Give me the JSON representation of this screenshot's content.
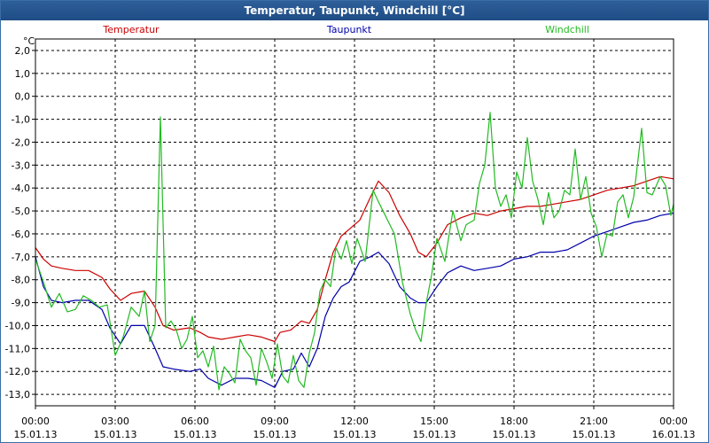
{
  "window": {
    "title": "Temperatur, Taupunkt, Windchill [°C]"
  },
  "chart_data": {
    "type": "line",
    "unit": "°C",
    "ylim": [
      -13.5,
      2.5
    ],
    "xlim": [
      0,
      24
    ],
    "grid": true,
    "y_ticks": [
      2.0,
      1.0,
      0.0,
      -1.0,
      -2.0,
      -3.0,
      -4.0,
      -5.0,
      -6.0,
      -7.0,
      -8.0,
      -9.0,
      -10.0,
      -11.0,
      -12.0,
      -13.0
    ],
    "y_tick_labels": [
      "2,0",
      "1,0",
      "0,0",
      "-1,0",
      "-2,0",
      "-3,0",
      "-4,0",
      "-5,0",
      "-6,0",
      "-7,0",
      "-8,0",
      "-9,0",
      "-10,0",
      "-11,0",
      "-12,0",
      "-13,0"
    ],
    "x_ticks": [
      {
        "hours": 0,
        "time": "00:00",
        "date": "15.01.13"
      },
      {
        "hours": 3,
        "time": "03:00",
        "date": "15.01.13"
      },
      {
        "hours": 6,
        "time": "06:00",
        "date": "15.01.13"
      },
      {
        "hours": 9,
        "time": "09:00",
        "date": "15.01.13"
      },
      {
        "hours": 12,
        "time": "12:00",
        "date": "15.01.13"
      },
      {
        "hours": 15,
        "time": "15:00",
        "date": "15.01.13"
      },
      {
        "hours": 18,
        "time": "18:00",
        "date": "15.01.13"
      },
      {
        "hours": 21,
        "time": "21:00",
        "date": "15.01.13"
      },
      {
        "hours": 24,
        "time": "00:00",
        "date": "16.01.13"
      }
    ],
    "series": [
      {
        "name": "Temperatur",
        "color": "#cc0000",
        "points": [
          [
            0,
            -6.6
          ],
          [
            0.3,
            -7.1
          ],
          [
            0.6,
            -7.4
          ],
          [
            1,
            -7.5
          ],
          [
            1.5,
            -7.6
          ],
          [
            2,
            -7.6
          ],
          [
            2.5,
            -7.9
          ],
          [
            2.8,
            -8.4
          ],
          [
            3.2,
            -8.9
          ],
          [
            3.6,
            -8.6
          ],
          [
            4.1,
            -8.5
          ],
          [
            4.5,
            -9.2
          ],
          [
            4.8,
            -10.0
          ],
          [
            5.2,
            -10.2
          ],
          [
            5.8,
            -10.1
          ],
          [
            6.2,
            -10.3
          ],
          [
            6.5,
            -10.5
          ],
          [
            7,
            -10.6
          ],
          [
            7.5,
            -10.5
          ],
          [
            8,
            -10.4
          ],
          [
            8.5,
            -10.5
          ],
          [
            9,
            -10.7
          ],
          [
            9.2,
            -10.3
          ],
          [
            9.6,
            -10.2
          ],
          [
            10,
            -9.8
          ],
          [
            10.3,
            -9.9
          ],
          [
            10.6,
            -9.3
          ],
          [
            10.9,
            -8.0
          ],
          [
            11.2,
            -6.8
          ],
          [
            11.5,
            -6.1
          ],
          [
            11.8,
            -5.8
          ],
          [
            12.2,
            -5.4
          ],
          [
            12.6,
            -4.4
          ],
          [
            12.9,
            -3.7
          ],
          [
            13.3,
            -4.2
          ],
          [
            13.7,
            -5.2
          ],
          [
            14.1,
            -6.0
          ],
          [
            14.4,
            -6.8
          ],
          [
            14.7,
            -7.0
          ],
          [
            15.1,
            -6.4
          ],
          [
            15.5,
            -5.6
          ],
          [
            16,
            -5.3
          ],
          [
            16.5,
            -5.1
          ],
          [
            17,
            -5.2
          ],
          [
            17.5,
            -5.0
          ],
          [
            18,
            -4.9
          ],
          [
            18.5,
            -4.8
          ],
          [
            19,
            -4.8
          ],
          [
            19.5,
            -4.7
          ],
          [
            20,
            -4.6
          ],
          [
            20.5,
            -4.5
          ],
          [
            21,
            -4.3
          ],
          [
            21.5,
            -4.1
          ],
          [
            22,
            -4.0
          ],
          [
            22.5,
            -3.9
          ],
          [
            23,
            -3.7
          ],
          [
            23.5,
            -3.5
          ],
          [
            24,
            -3.6
          ]
        ]
      },
      {
        "name": "Taupunkt",
        "color": "#0000aa",
        "points": [
          [
            0,
            -7.0
          ],
          [
            0.3,
            -8.3
          ],
          [
            0.6,
            -8.9
          ],
          [
            1,
            -9.0
          ],
          [
            1.5,
            -8.9
          ],
          [
            2,
            -8.9
          ],
          [
            2.5,
            -9.3
          ],
          [
            2.8,
            -10.1
          ],
          [
            3.2,
            -10.8
          ],
          [
            3.6,
            -10.0
          ],
          [
            4.1,
            -10.0
          ],
          [
            4.5,
            -11.0
          ],
          [
            4.8,
            -11.8
          ],
          [
            5.2,
            -11.9
          ],
          [
            5.8,
            -12.0
          ],
          [
            6.2,
            -11.9
          ],
          [
            6.5,
            -12.3
          ],
          [
            7,
            -12.6
          ],
          [
            7.5,
            -12.3
          ],
          [
            8,
            -12.3
          ],
          [
            8.5,
            -12.4
          ],
          [
            9,
            -12.7
          ],
          [
            9.3,
            -12.0
          ],
          [
            9.7,
            -11.9
          ],
          [
            10,
            -11.2
          ],
          [
            10.3,
            -11.8
          ],
          [
            10.6,
            -11.0
          ],
          [
            10.9,
            -9.6
          ],
          [
            11.2,
            -8.8
          ],
          [
            11.5,
            -8.3
          ],
          [
            11.8,
            -8.1
          ],
          [
            12.2,
            -7.2
          ],
          [
            12.6,
            -7.0
          ],
          [
            12.9,
            -6.8
          ],
          [
            13.3,
            -7.3
          ],
          [
            13.7,
            -8.3
          ],
          [
            14.1,
            -8.8
          ],
          [
            14.4,
            -9.0
          ],
          [
            14.7,
            -9.0
          ],
          [
            15.1,
            -8.3
          ],
          [
            15.5,
            -7.7
          ],
          [
            16,
            -7.4
          ],
          [
            16.5,
            -7.6
          ],
          [
            17,
            -7.5
          ],
          [
            17.5,
            -7.4
          ],
          [
            18,
            -7.1
          ],
          [
            18.5,
            -7.0
          ],
          [
            19,
            -6.8
          ],
          [
            19.5,
            -6.8
          ],
          [
            20,
            -6.7
          ],
          [
            20.5,
            -6.4
          ],
          [
            21,
            -6.1
          ],
          [
            21.5,
            -5.9
          ],
          [
            22,
            -5.7
          ],
          [
            22.5,
            -5.5
          ],
          [
            23,
            -5.4
          ],
          [
            23.5,
            -5.2
          ],
          [
            24,
            -5.1
          ]
        ]
      },
      {
        "name": "Windchill",
        "color": "#22bb22",
        "points": [
          [
            0,
            -7.1
          ],
          [
            0.3,
            -8.1
          ],
          [
            0.6,
            -9.2
          ],
          [
            0.9,
            -8.6
          ],
          [
            1.2,
            -9.4
          ],
          [
            1.5,
            -9.3
          ],
          [
            1.8,
            -8.7
          ],
          [
            2.1,
            -8.9
          ],
          [
            2.4,
            -9.2
          ],
          [
            2.7,
            -9.1
          ],
          [
            3,
            -11.3
          ],
          [
            3.3,
            -10.5
          ],
          [
            3.6,
            -9.2
          ],
          [
            3.9,
            -9.6
          ],
          [
            4.1,
            -8.5
          ],
          [
            4.3,
            -10.7
          ],
          [
            4.5,
            -10.0
          ],
          [
            4.7,
            -0.9
          ],
          [
            4.9,
            -10.1
          ],
          [
            5.1,
            -9.8
          ],
          [
            5.3,
            -10.2
          ],
          [
            5.5,
            -11.0
          ],
          [
            5.7,
            -10.6
          ],
          [
            5.9,
            -9.6
          ],
          [
            6.1,
            -11.4
          ],
          [
            6.3,
            -11.1
          ],
          [
            6.5,
            -11.8
          ],
          [
            6.7,
            -10.9
          ],
          [
            6.9,
            -12.8
          ],
          [
            7.1,
            -11.8
          ],
          [
            7.3,
            -12.1
          ],
          [
            7.5,
            -12.5
          ],
          [
            7.7,
            -10.6
          ],
          [
            7.9,
            -11.1
          ],
          [
            8.1,
            -11.4
          ],
          [
            8.3,
            -12.6
          ],
          [
            8.5,
            -11.0
          ],
          [
            8.7,
            -11.6
          ],
          [
            8.9,
            -12.3
          ],
          [
            9.1,
            -10.8
          ],
          [
            9.3,
            -12.2
          ],
          [
            9.5,
            -12.5
          ],
          [
            9.7,
            -11.3
          ],
          [
            9.9,
            -12.4
          ],
          [
            10.1,
            -12.7
          ],
          [
            10.3,
            -11.2
          ],
          [
            10.5,
            -10.3
          ],
          [
            10.7,
            -8.5
          ],
          [
            10.9,
            -8.0
          ],
          [
            11.1,
            -8.3
          ],
          [
            11.3,
            -6.6
          ],
          [
            11.5,
            -7.1
          ],
          [
            11.7,
            -6.3
          ],
          [
            11.9,
            -7.3
          ],
          [
            12.1,
            -6.2
          ],
          [
            12.4,
            -7.2
          ],
          [
            12.7,
            -4.1
          ],
          [
            12.9,
            -4.6
          ],
          [
            13.2,
            -5.3
          ],
          [
            13.5,
            -6.0
          ],
          [
            13.8,
            -8.1
          ],
          [
            14.1,
            -9.5
          ],
          [
            14.3,
            -10.2
          ],
          [
            14.5,
            -10.7
          ],
          [
            14.7,
            -9.0
          ],
          [
            14.9,
            -7.8
          ],
          [
            15.1,
            -6.2
          ],
          [
            15.4,
            -7.2
          ],
          [
            15.7,
            -5.0
          ],
          [
            16,
            -6.3
          ],
          [
            16.2,
            -5.6
          ],
          [
            16.5,
            -5.4
          ],
          [
            16.7,
            -3.8
          ],
          [
            16.9,
            -3.0
          ],
          [
            17.1,
            -0.7
          ],
          [
            17.3,
            -4.0
          ],
          [
            17.5,
            -4.8
          ],
          [
            17.7,
            -4.3
          ],
          [
            17.9,
            -5.3
          ],
          [
            18.1,
            -3.3
          ],
          [
            18.3,
            -4.0
          ],
          [
            18.5,
            -1.8
          ],
          [
            18.7,
            -3.7
          ],
          [
            18.9,
            -4.5
          ],
          [
            19.1,
            -5.6
          ],
          [
            19.3,
            -4.2
          ],
          [
            19.5,
            -5.3
          ],
          [
            19.7,
            -5.0
          ],
          [
            19.9,
            -4.1
          ],
          [
            20.1,
            -4.3
          ],
          [
            20.3,
            -2.3
          ],
          [
            20.5,
            -4.5
          ],
          [
            20.7,
            -3.5
          ],
          [
            20.9,
            -5.1
          ],
          [
            21.1,
            -5.7
          ],
          [
            21.3,
            -7.0
          ],
          [
            21.5,
            -6.0
          ],
          [
            21.7,
            -6.1
          ],
          [
            21.9,
            -4.6
          ],
          [
            22.1,
            -4.3
          ],
          [
            22.3,
            -5.3
          ],
          [
            22.5,
            -4.4
          ],
          [
            22.8,
            -1.4
          ],
          [
            23,
            -4.2
          ],
          [
            23.2,
            -4.3
          ],
          [
            23.5,
            -3.5
          ],
          [
            23.7,
            -3.9
          ],
          [
            23.9,
            -5.2
          ],
          [
            24,
            -4.7
          ]
        ]
      }
    ]
  }
}
